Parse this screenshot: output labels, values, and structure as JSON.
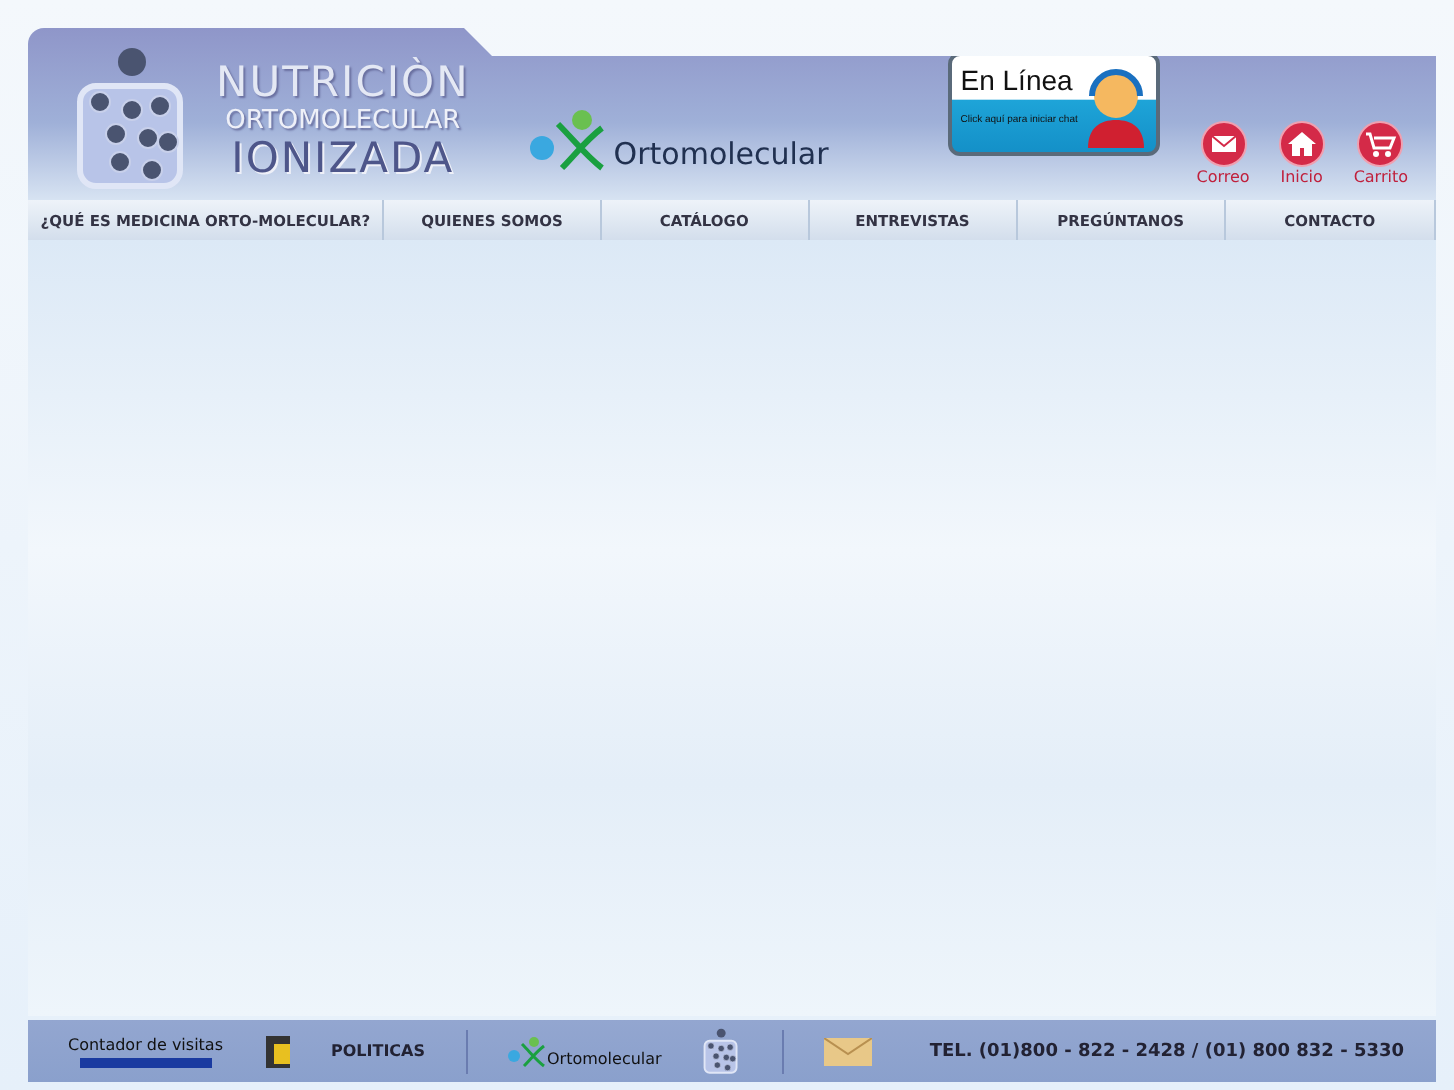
{
  "brand": {
    "line1": "NUTRICIÒN",
    "line2": "ORTOMOLECULAR",
    "line3": "IONIZADA",
    "logo2": "Ortomolecular"
  },
  "chat": {
    "title": "En Línea",
    "subtitle": "Click aquí para iniciar chat"
  },
  "quick_links": [
    {
      "kind": "mail",
      "label": "Correo"
    },
    {
      "kind": "home",
      "label": "Inicio"
    },
    {
      "kind": "cart",
      "label": "Carrito"
    }
  ],
  "nav": [
    {
      "label": "¿QUÉ ES MEDICINA ORTO-MOLECULAR?"
    },
    {
      "label": "QUIENES SOMOS"
    },
    {
      "label": "CATÁLOGO"
    },
    {
      "label": "ENTREVISTAS"
    },
    {
      "label": "PREGÚNTANOS"
    },
    {
      "label": "CONTACTO"
    }
  ],
  "footer": {
    "counter": "Contador de visitas",
    "policies": "POLITICAS",
    "logo2": "Ortomolecular",
    "phone": "TEL. (01)800 - 822 - 2428  / (01) 800 832 - 5330"
  }
}
